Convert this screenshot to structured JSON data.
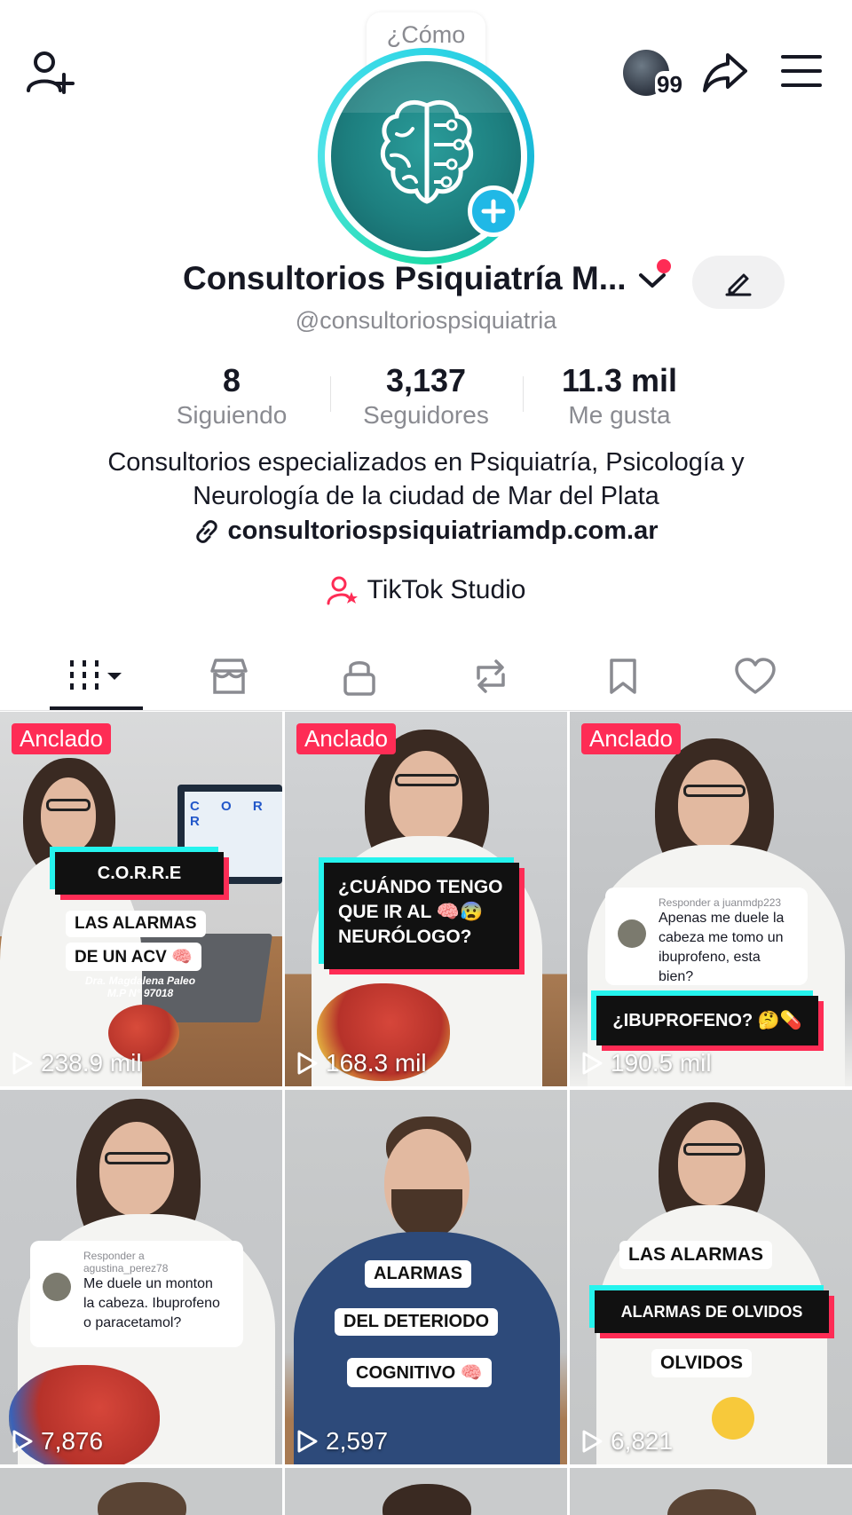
{
  "header": {
    "add_friend_icon": "person-plus-icon",
    "visitors_badge": "99",
    "share_icon": "share-arrow-icon",
    "menu_icon": "hamburger-menu-icon"
  },
  "profile": {
    "mood_bubble": "¿Cómo estás?",
    "name": "Consultorios Psiquiatría M...",
    "handle": "@consultoriospsiquiatria",
    "avatar_icon": "brain-circuit-icon"
  },
  "stats": [
    {
      "value": "8",
      "label": "Siguiendo"
    },
    {
      "value": "3,137",
      "label": "Seguidores"
    },
    {
      "value": "11.3 mil",
      "label": "Me gusta"
    }
  ],
  "bio": {
    "line1": "Consultorios especializados en Psiquiatría, Psicología y",
    "line2": "Neurología de la ciudad de Mar del Plata",
    "link": "consultoriospsiquiatriamdp.com.ar"
  },
  "studio": {
    "label": "TikTok Studio"
  },
  "tabs": [
    {
      "name": "videos",
      "icon": "grid-bars-icon",
      "active": true
    },
    {
      "name": "shop",
      "icon": "shop-icon"
    },
    {
      "name": "private",
      "icon": "lock-icon"
    },
    {
      "name": "reposts",
      "icon": "repost-icon"
    },
    {
      "name": "saved",
      "icon": "bookmark-icon"
    },
    {
      "name": "liked",
      "icon": "heart-icon"
    }
  ],
  "videos": [
    {
      "pinned": "Anclado",
      "views": "238.9 mil",
      "caption1": "C.O.R.R.E",
      "caption2": "LAS ALARMAS",
      "caption3": "DE UN ACV 🧠",
      "credit1": "Dra. Magdalena Paleo",
      "credit2": "M.P N° 97018",
      "board": "C O R R"
    },
    {
      "pinned": "Anclado",
      "views": "168.3 mil",
      "caption1": "¿CUÁNDO TENGO",
      "caption2": "QUE IR AL 🧠😰",
      "caption3": "NEURÓLOGO?"
    },
    {
      "pinned": "Anclado",
      "views": "190.5 mil",
      "reply_to": "Responder a juanmdp223",
      "reply1": "Apenas me duele la",
      "reply2": "cabeza me tomo un",
      "reply3": "ibuprofeno, esta bien?",
      "caption1": "¿IBUPROFENO? 🤔💊"
    },
    {
      "views": "7,876",
      "reply_to": "Responder a agustina_perez78",
      "reply1": "Me duele un monton",
      "reply2": "la cabeza. Ibuprofeno",
      "reply3": "o paracetamol?"
    },
    {
      "views": "2,597",
      "caption1": "ALARMAS",
      "caption2": "DEL DETERIODO",
      "caption3": "COGNITIVO 🧠"
    },
    {
      "views": "6,821",
      "caption1": "LAS ALARMAS",
      "caption2": "ALARMAS DE OLVIDOS",
      "caption3": "OLVIDOS"
    }
  ],
  "colors": {
    "accent": "#fe2c55",
    "cyan": "#25f4ee",
    "avatar_teal": "#1d7f7f"
  }
}
